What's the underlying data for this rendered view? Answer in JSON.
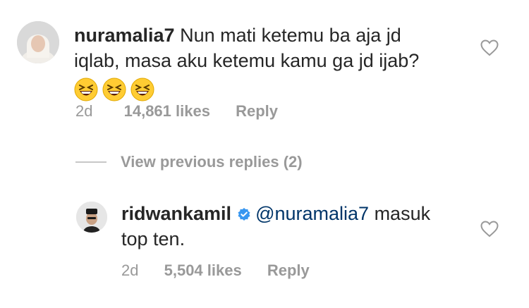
{
  "comment": {
    "username": "nuramalia7",
    "text_line1": "Nun mati ketemu ba aja jd",
    "text_line2": "iqlab, masa aku ketemu kamu ga jd ijab?",
    "time": "2d",
    "likes": "14,861 likes",
    "reply_label": "Reply",
    "emojis": [
      "grinning-squinting-face-icon",
      "grinning-squinting-face-icon",
      "grinning-squinting-face-icon"
    ]
  },
  "view_previous": {
    "label": "View previous replies (2)"
  },
  "reply": {
    "username": "ridwankamil",
    "mention": "@nuramalia7",
    "text_line1_rest": " masuk",
    "text_line2": "top ten.",
    "time": "2d",
    "likes": "5,504 likes",
    "reply_label": "Reply"
  },
  "colors": {
    "text": "#262626",
    "meta": "#999999",
    "mention": "#003569",
    "verified": "#3897f0"
  }
}
